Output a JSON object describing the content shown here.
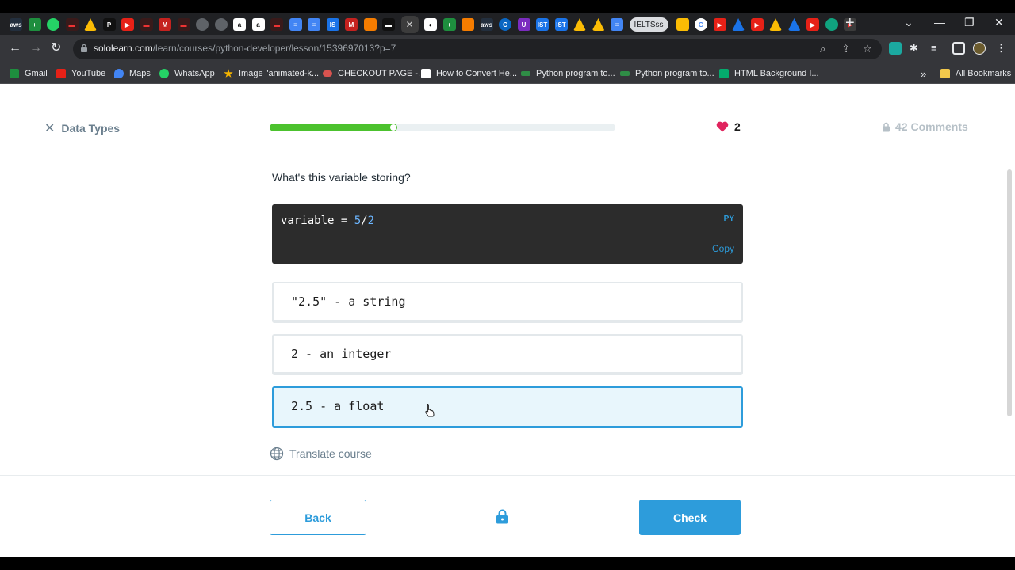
{
  "browser": {
    "tabs_active_icon": "close-icon",
    "pill_label": "IELTSss",
    "new_tab_label": "+",
    "url_host": "sololearn.com",
    "url_path": "/learn/courses/python-developer/lesson/1539697013?p=7",
    "bookmarks": [
      {
        "label": "Gmail",
        "color": "#1e8e3e"
      },
      {
        "label": "YouTube",
        "color": "#e62117"
      },
      {
        "label": "Maps",
        "color": "#4285f4"
      },
      {
        "label": "WhatsApp",
        "color": "#25d366"
      },
      {
        "label": "Image \"animated-k...",
        "color": "#f4b400"
      },
      {
        "label": "CHECKOUT PAGE -...",
        "color": "#d9534f"
      },
      {
        "label": "How to Convert He...",
        "color": "#ffffff"
      },
      {
        "label": "Python program to...",
        "color": "#2f8d46"
      },
      {
        "label": "Python program to...",
        "color": "#2f8d46"
      },
      {
        "label": "HTML Background I...",
        "color": "#04aa6d"
      }
    ],
    "bookmarks_overflow": "»",
    "all_bookmarks": "All Bookmarks"
  },
  "lesson": {
    "title": "Data Types",
    "progress_fraction": 0.37,
    "hearts": "2",
    "comments": "42 Comments"
  },
  "question": {
    "prompt": "What's this variable storing?",
    "code_lang": "PY",
    "copy_label": "Copy",
    "code_prefix": "variable = ",
    "code_num1": "5",
    "code_op": "/",
    "code_num2": "2",
    "options": [
      {
        "text": "\"2.5\" - a string",
        "selected": false
      },
      {
        "text": "2 - an integer",
        "selected": false
      },
      {
        "text": "2.5 - a float",
        "selected": true
      }
    ]
  },
  "translate_label": "Translate course",
  "footer": {
    "back_label": "Back",
    "check_label": "Check"
  },
  "colors": {
    "accent": "#2d9cdb",
    "progress": "#4cc22e",
    "heart": "#e0245e"
  }
}
